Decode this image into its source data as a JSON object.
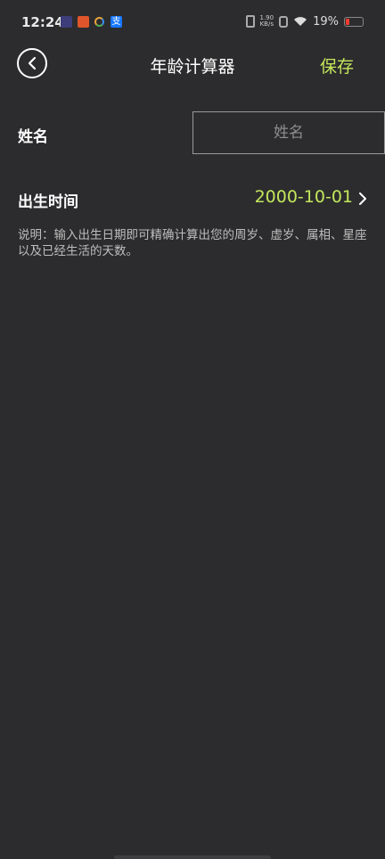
{
  "status_bar": {
    "time": "12:24",
    "net_speed_value": "1.90",
    "net_speed_unit": "KB/s",
    "battery_percent": "19%",
    "notification_icons": [
      "video-icon",
      "app-orange-icon",
      "app-ring-icon",
      "alipay-icon"
    ]
  },
  "header": {
    "title": "年龄计算器",
    "save_label": "保存"
  },
  "form": {
    "name_label": "姓名",
    "name_placeholder": "姓名",
    "name_value": "",
    "birth_label": "出生时间",
    "birth_value": "2000-10-01"
  },
  "note": "说明：输入出生日期即可精确计算出您的周岁、虚岁、属相、星座以及已经生活的天数。",
  "colors": {
    "background": "#2c2c2e",
    "accent": "#c4e75b",
    "text": "#ffffff",
    "muted": "#bdbdbd"
  }
}
